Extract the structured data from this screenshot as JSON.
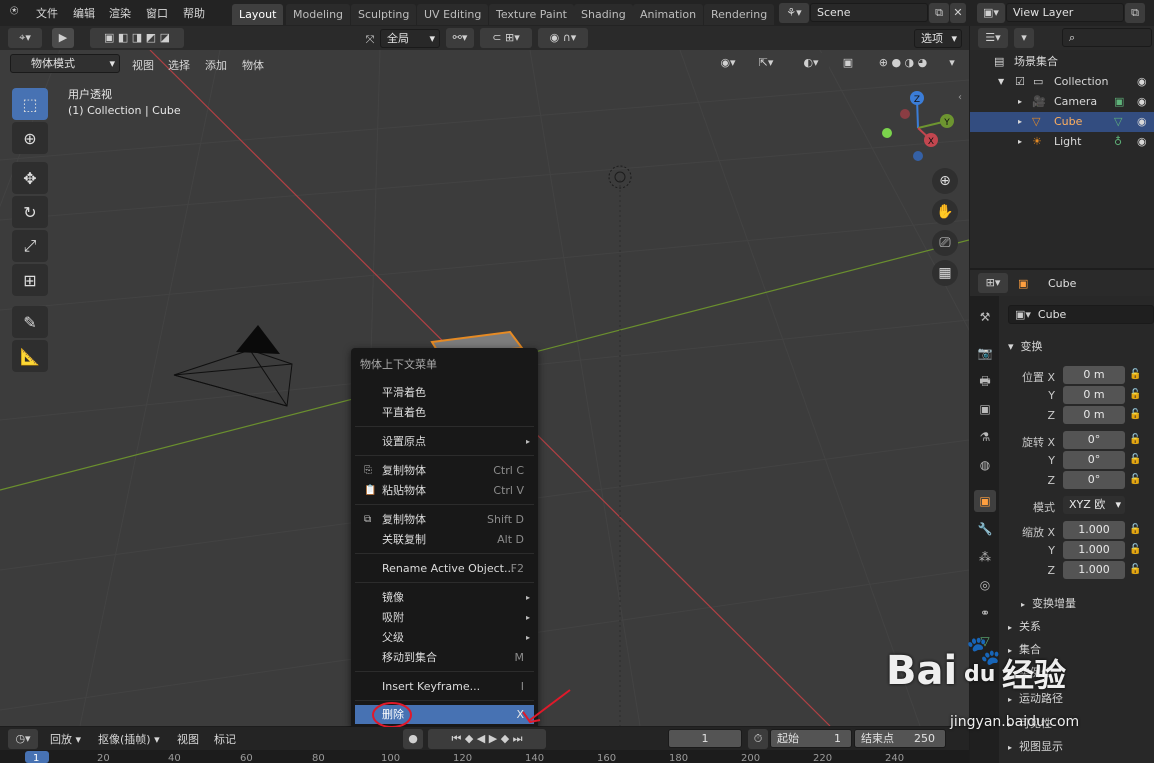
{
  "menubar": {
    "items": [
      "文件",
      "编辑",
      "渲染",
      "窗口",
      "帮助"
    ],
    "workspaces": [
      "Layout",
      "Modeling",
      "Sculpting",
      "UV Editing",
      "Texture Paint",
      "Shading",
      "Animation",
      "Rendering"
    ],
    "active_workspace": "Layout",
    "scene": "Scene",
    "view_layer": "View Layer"
  },
  "viewport_header": {
    "transform_orientation": "全局",
    "options": "选项",
    "mode": "物体模式",
    "menus": [
      "视图",
      "选择",
      "添加",
      "物体"
    ]
  },
  "viewport": {
    "title": "用户透视",
    "subtitle": "(1) Collection | Cube",
    "gizmo_axes": [
      "Z",
      "Y",
      "X"
    ]
  },
  "context_menu": {
    "title": "物体上下文菜单",
    "items": [
      {
        "label": "平滑着色",
        "shortcut": ""
      },
      {
        "label": "平直着色",
        "shortcut": ""
      },
      {
        "label": "设置原点",
        "shortcut": "▸"
      },
      {
        "label": "复制物体",
        "shortcut": "Ctrl C"
      },
      {
        "label": "粘贴物体",
        "shortcut": "Ctrl V"
      },
      {
        "label": "复制物体",
        "shortcut": "Shift D"
      },
      {
        "label": "关联复制",
        "shortcut": "Alt D"
      },
      {
        "label": "Rename Active Object...",
        "shortcut": "F2"
      },
      {
        "label": "镜像",
        "shortcut": "▸"
      },
      {
        "label": "吸附",
        "shortcut": "▸"
      },
      {
        "label": "父级",
        "shortcut": "▸"
      },
      {
        "label": "移动到集合",
        "shortcut": "M"
      },
      {
        "label": "Insert Keyframe...",
        "shortcut": "I"
      },
      {
        "label": "删除",
        "shortcut": "X"
      }
    ],
    "highlighted": "删除"
  },
  "outliner": {
    "root": "场景集合",
    "collection": "Collection",
    "objects": [
      "Camera",
      "Cube",
      "Light"
    ],
    "selected": "Cube"
  },
  "properties": {
    "header_object": "Cube",
    "object_name": "Cube",
    "transform_title": "变换",
    "location_label": "位置",
    "rotation_label": "旋转",
    "scale_label": "缩放",
    "axes": [
      "X",
      "Y",
      "Z"
    ],
    "location": [
      "0 m",
      "0 m",
      "0 m"
    ],
    "rotation": [
      "0°",
      "0°",
      "0°"
    ],
    "mode_label": "模式",
    "mode_value": "XYZ 欧",
    "scale": [
      "1.000",
      "1.000",
      "1.000"
    ],
    "sections": [
      "变换增量",
      "关系",
      "集合",
      "实例化",
      "运动路径",
      "可见性",
      "视图显示"
    ]
  },
  "timeline": {
    "playback": "回放",
    "keying": "抠像(插帧)",
    "view": "视图",
    "marker": "标记",
    "current_frame": "1",
    "start_label": "起始",
    "start": "1",
    "end_label": "结束点",
    "end": "250"
  },
  "ruler": [
    "1",
    "20",
    "40",
    "60",
    "80",
    "100",
    "120",
    "140",
    "160",
    "180",
    "200",
    "220",
    "240"
  ],
  "watermark": {
    "brand": "Bai",
    "paw": "du",
    "jingyan": "经验",
    "url": "jingyan.baidu.com"
  },
  "colors": {
    "accent": "#4772b3",
    "selected_row": "#334d80",
    "x_axis": "#c2464f",
    "y_axis": "#6d9530",
    "z_axis": "#3b7dd8",
    "origin": "#e58a24"
  }
}
